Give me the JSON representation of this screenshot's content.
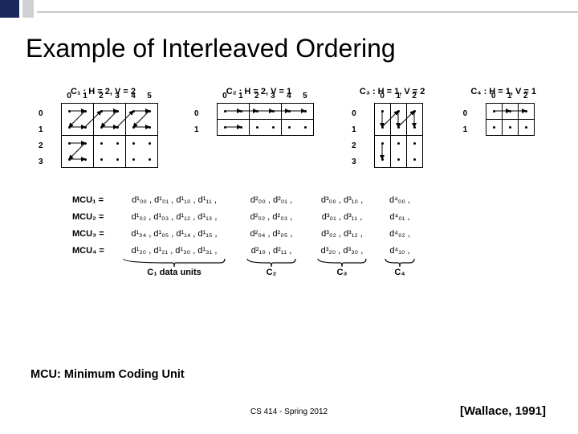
{
  "header": {
    "title": "Example of Interleaved Ordering"
  },
  "components": [
    {
      "name": "C₁",
      "H": 2,
      "V": 2,
      "cols": 6,
      "rows": 4,
      "cell": 20
    },
    {
      "name": "C₂",
      "H": 2,
      "V": 1,
      "cols": 6,
      "rows": 2,
      "cell": 20
    },
    {
      "name": "C₃",
      "H": 1,
      "V": 2,
      "cols": 3,
      "rows": 4,
      "cell": 20
    },
    {
      "name": "C₄",
      "H": 1,
      "V": 1,
      "cols": 3,
      "rows": 2,
      "cell": 20
    }
  ],
  "mcu_rows": [
    {
      "lhs": "MCU₁ =",
      "c1": [
        "d¹₀₀",
        "d¹₀₁",
        "d¹₁₀",
        "d¹₁₁"
      ],
      "c2": [
        "d²₀₀",
        "d²₀₁"
      ],
      "c3": [
        "d³₀₀",
        "d³₁₀"
      ],
      "c4": [
        "d⁴₀₀"
      ]
    },
    {
      "lhs": "MCU₂ =",
      "c1": [
        "d¹₀₂",
        "d¹₀₃",
        "d¹₁₂",
        "d¹₁₃"
      ],
      "c2": [
        "d²₀₂",
        "d²₀₃"
      ],
      "c3": [
        "d³₀₁",
        "d³₁₁"
      ],
      "c4": [
        "d⁴₀₁"
      ]
    },
    {
      "lhs": "MCU₃ =",
      "c1": [
        "d¹₀₄",
        "d¹₀₅",
        "d¹₁₄",
        "d¹₁₅"
      ],
      "c2": [
        "d²₀₄",
        "d²₀₅"
      ],
      "c3": [
        "d³₀₂",
        "d³₁₂"
      ],
      "c4": [
        "d⁴₀₂"
      ]
    },
    {
      "lhs": "MCU₄ =",
      "c1": [
        "d¹₂₀",
        "d¹₂₁",
        "d¹₃₀",
        "d¹₃₁"
      ],
      "c2": [
        "d²₁₀",
        "d²₁₁"
      ],
      "c3": [
        "d³₂₀",
        "d³₃₀"
      ],
      "c4": [
        "d⁴₁₀"
      ]
    }
  ],
  "brace_labels": [
    "C₁ data units",
    "C₂",
    "C₃",
    "C₄"
  ],
  "brace_widths": [
    130,
    64,
    64,
    40
  ],
  "brace_gaps": [
    0,
    24,
    24,
    20
  ],
  "subtitle": "MCU: Minimum Coding Unit",
  "footer_center": "CS 414 - Spring 2012",
  "citation": "[Wallace, 1991]"
}
